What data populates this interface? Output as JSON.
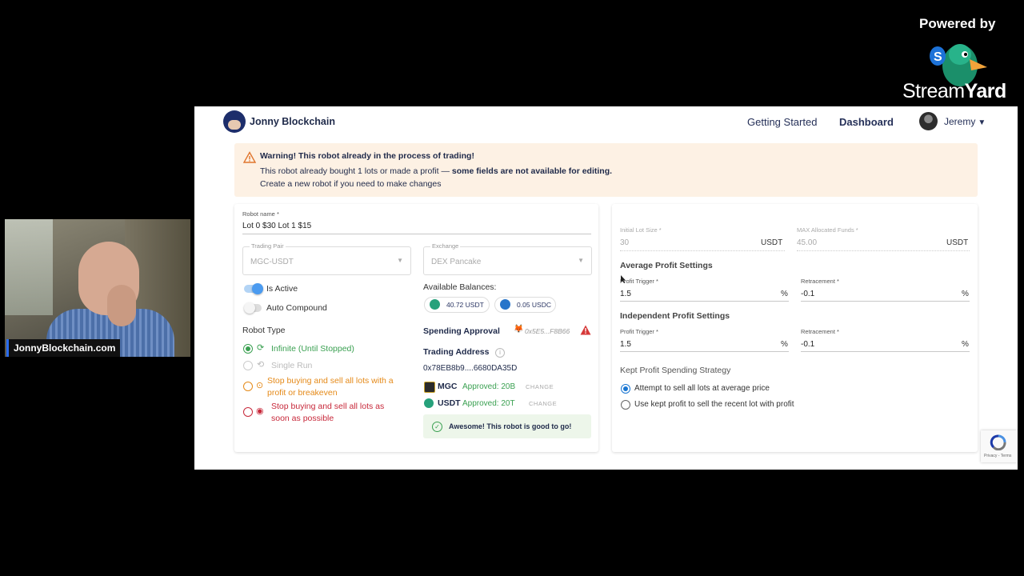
{
  "branding": {
    "powered_by": "Powered by",
    "stream": "Stream",
    "yard": "Yard"
  },
  "webcam": {
    "name_tag": "JonnyBlockchain.com"
  },
  "nav": {
    "brand": "Jonny Blockchain",
    "getting_started": "Getting Started",
    "dashboard": "Dashboard",
    "user": "Jeremy",
    "caret": "▼"
  },
  "warning": {
    "title": "Warning! This robot already in the process of trading!",
    "line1_prefix": "This robot already bought 1 lots or made a profit —",
    "line1_bold": "some fields are not available for editing.",
    "line2": "Create a new robot if you need to make changes"
  },
  "robot": {
    "name_label": "Robot name *",
    "name_value": "Lot 0 $30 Lot 1 $15",
    "pair_label": "Trading Pair",
    "pair_value": "MGC-USDT",
    "exchange_label": "Exchange",
    "exchange_value": "DEX Pancake",
    "is_active": "Is Active",
    "auto_compound": "Auto Compound",
    "type_label": "Robot Type",
    "types": [
      {
        "label": "Infinite (Until Stopped)"
      },
      {
        "label": "Single Run"
      },
      {
        "label": "Stop buying and sell all lots with a profit or breakeven"
      },
      {
        "label": "Stop buying and sell all lots as soon as possible"
      }
    ]
  },
  "balances": {
    "label": "Available Balances:",
    "usdt": "40.72 USDT",
    "usdc": "0.05 USDC"
  },
  "spending": {
    "label": "Spending Approval",
    "address": "0x5E5...F8B66"
  },
  "trading": {
    "label": "Trading Address",
    "info": "i",
    "address": "0x78EB8b9....6680DA35D",
    "tokens": [
      {
        "name": "MGC",
        "approved": "Approved: 20B",
        "change": "CHANGE"
      },
      {
        "name": "USDT",
        "approved": "Approved: 20T",
        "change": "CHANGE"
      }
    ]
  },
  "success": {
    "text": "Awesome! This robot is good to go!",
    "icon": "✓"
  },
  "settings": {
    "initial_lot_label": "Initial Lot Size *",
    "initial_lot_value": "30",
    "initial_lot_unit": "USDT",
    "max_funds_label": "MAX Allocated Funds *",
    "max_funds_value": "45.00",
    "max_funds_unit": "USDT",
    "avg_title": "Average Profit Settings",
    "avg_trigger_label": "Profit Trigger *",
    "avg_trigger_value": "1.5",
    "avg_retr_label": "Retracement *",
    "avg_retr_value": "-0.1",
    "ind_title": "Independent Profit Settings",
    "ind_trigger_label": "Profit Trigger *",
    "ind_trigger_value": "1.5",
    "ind_retr_label": "Retracement *",
    "ind_retr_value": "-0.1",
    "percent": "%",
    "kept_title": "Kept Profit Spending Strategy",
    "kept_options": [
      {
        "label": "Attempt to sell all lots at average price"
      },
      {
        "label": "Use kept profit to sell the recent lot with profit"
      }
    ]
  },
  "recaptcha": {
    "text": "Privacy - Terms"
  }
}
